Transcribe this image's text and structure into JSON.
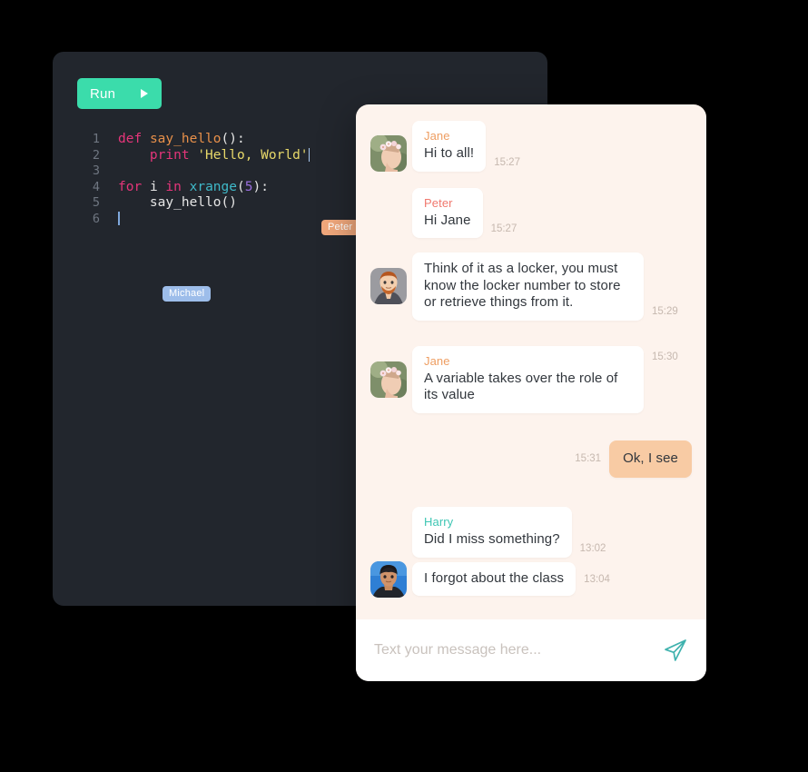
{
  "editor": {
    "run_button": {
      "label": "Run",
      "icon": "play-icon",
      "color": "#3BDCAB"
    },
    "lines": [
      {
        "number": "1",
        "text": "def say_hello():"
      },
      {
        "number": "2",
        "text": "    print 'Hello, World'"
      },
      {
        "number": "3",
        "text": ""
      },
      {
        "number": "4",
        "text": "for i in xrange(5):"
      },
      {
        "number": "5",
        "text": "    say_hello()"
      },
      {
        "number": "6",
        "text": ""
      }
    ],
    "tokens": {
      "def": "def",
      "fn_name": "say_hello",
      "parens_colon": "():",
      "indent": "    ",
      "print": "print",
      "string": "'Hello, World'",
      "for": "for",
      "var_i": "i",
      "in": "in",
      "xrange": "xrange",
      "open_paren": "(",
      "five": "5",
      "close_paren_colon": "):",
      "call": "say_hello()"
    },
    "collaborators": [
      {
        "name": "Peter",
        "color": "#F1A87C"
      },
      {
        "name": "Michael",
        "color": "#9DBDEA"
      }
    ]
  },
  "chat": {
    "background": "#FDF3ED",
    "messages": [
      {
        "sender": "Jane",
        "sender_class": "jane",
        "text": "Hi to all!",
        "time": "15:27",
        "direction": "in",
        "show_avatar": true,
        "show_sender": true,
        "avatar": "jane-avatar"
      },
      {
        "sender": "Peter",
        "sender_class": "peter",
        "text": "Hi Jane",
        "time": "15:27",
        "direction": "in",
        "show_avatar": false,
        "show_sender": true,
        "avatar": "peter-avatar"
      },
      {
        "sender": "Peter",
        "sender_class": "peter",
        "text": "Think of it as a locker, you must know the locker number to store or retrieve things from it.",
        "time": "15:29",
        "direction": "in",
        "show_avatar": true,
        "show_sender": false,
        "avatar": "peter-avatar"
      },
      {
        "sender": "Jane",
        "sender_class": "jane",
        "text": "A variable takes over the role of its value",
        "time": "15:30",
        "direction": "in",
        "show_avatar": true,
        "show_sender": true,
        "avatar": "jane-avatar"
      },
      {
        "sender": "",
        "sender_class": "",
        "text": "Ok, I see",
        "time": "15:31",
        "direction": "out",
        "show_avatar": false,
        "show_sender": false,
        "avatar": ""
      },
      {
        "sender": "Harry",
        "sender_class": "harry",
        "text": "Did I miss something?",
        "time": "13:02",
        "direction": "in",
        "show_avatar": false,
        "show_sender": true,
        "avatar": "harry-avatar"
      },
      {
        "sender": "Harry",
        "sender_class": "harry",
        "text": "I forgot about the class",
        "time": "13:04",
        "direction": "in",
        "show_avatar": true,
        "show_sender": false,
        "avatar": "harry-avatar"
      }
    ],
    "input": {
      "placeholder": "Text your message here...",
      "value": "",
      "send_icon": "paper-plane-icon",
      "send_icon_color": "#3FB2AE"
    }
  }
}
